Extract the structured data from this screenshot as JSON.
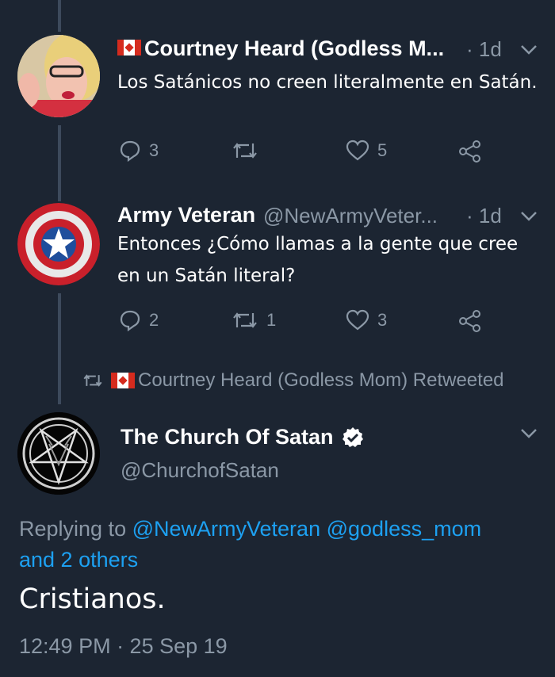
{
  "tweets": [
    {
      "author": "Courtney Heard (Godless M...",
      "time": "· 1d",
      "text": "Los Satánicos no creen literalmente en Satán.",
      "replies": "3",
      "retweets": "",
      "likes": "5"
    },
    {
      "author": "Army Veteran",
      "handle": "@NewArmyVeter...",
      "time": "· 1d",
      "text_line1": "Entonces ¿Cómo llamas a la gente que cree",
      "text_line2": "en un Satán literal?",
      "replies": "2",
      "retweets": "1",
      "likes": "3"
    }
  ],
  "retweet_notice": "Courtney Heard (Godless Mom) Retweeted",
  "main_tweet": {
    "author": "The Church Of Satan",
    "handle": "@ChurchofSatan",
    "replying_prefix": "Replying to ",
    "mention1": "@NewArmyVeteran",
    "mention2": "@godless_mom",
    "others": "and 2 others",
    "text": "Cristianos.",
    "timestamp": "12:49 PM · 25 Sep 19"
  },
  "colors": {
    "background": "#1c2532",
    "muted": "#8b98a6",
    "link": "#1da1f2",
    "thread_line": "#3d4a5c"
  },
  "icons": [
    "reply-icon",
    "retweet-icon",
    "like-icon",
    "share-icon",
    "chevron-down-icon",
    "verified-icon",
    "canada-flag-icon"
  ]
}
